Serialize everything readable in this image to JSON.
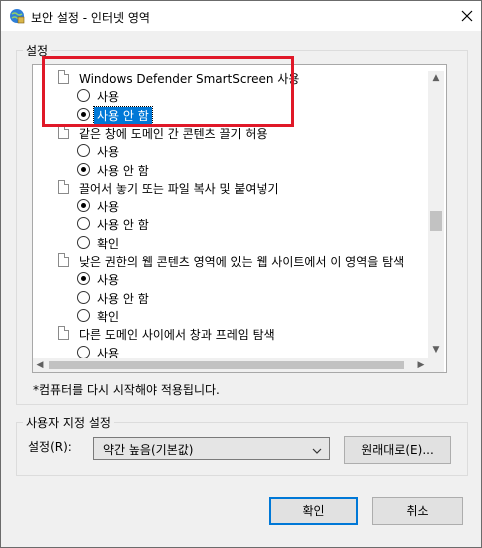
{
  "window": {
    "title": "보안 설정 - 인터넷 영역"
  },
  "settings_group": {
    "label": "설정",
    "items": [
      {
        "type": "category",
        "label": "Windows Defender SmartScreen 사용"
      },
      {
        "type": "option",
        "label": "사용",
        "checked": false,
        "selected": false
      },
      {
        "type": "option",
        "label": "사용 안 함",
        "checked": true,
        "selected": true
      },
      {
        "type": "category",
        "label": "같은 창에 도메인 간 콘텐츠 끌기 허용"
      },
      {
        "type": "option",
        "label": "사용",
        "checked": false,
        "selected": false
      },
      {
        "type": "option",
        "label": "사용 안 함",
        "checked": true,
        "selected": false
      },
      {
        "type": "category",
        "label": "끌어서 놓기 또는 파일 복사 및 붙여넣기"
      },
      {
        "type": "option",
        "label": "사용",
        "checked": true,
        "selected": false
      },
      {
        "type": "option",
        "label": "사용 안 함",
        "checked": false,
        "selected": false
      },
      {
        "type": "option",
        "label": "확인",
        "checked": false,
        "selected": false
      },
      {
        "type": "category",
        "label": "낮은 권한의 웹 콘텐츠 영역에 있는 웹 사이트에서 이 영역을 탐색"
      },
      {
        "type": "option",
        "label": "사용",
        "checked": true,
        "selected": false
      },
      {
        "type": "option",
        "label": "사용 안 함",
        "checked": false,
        "selected": false
      },
      {
        "type": "option",
        "label": "확인",
        "checked": false,
        "selected": false
      },
      {
        "type": "category",
        "label": "다른 도메인 사이에서 창과 프레임 탐색"
      },
      {
        "type": "option",
        "label": "사용",
        "checked": false,
        "selected": false
      }
    ],
    "note": "*컴퓨터를 다시 시작해야 적용됩니다."
  },
  "custom_group": {
    "label": "사용자 지정 설정",
    "level_label": "설정(R):",
    "level_value": "약간 높음(기본값)",
    "reset_label": "원래대로(E)..."
  },
  "buttons": {
    "ok": "확인",
    "cancel": "취소"
  }
}
